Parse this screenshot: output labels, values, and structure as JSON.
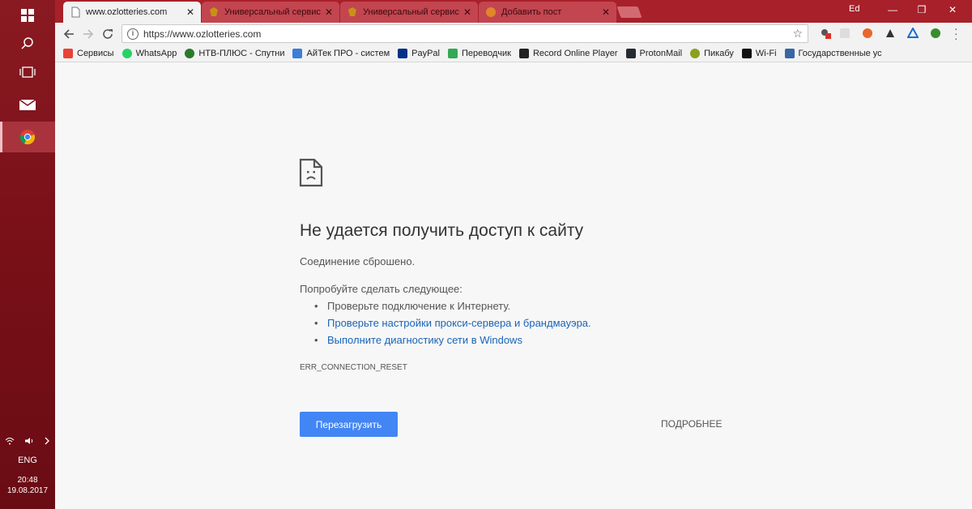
{
  "taskbar": {
    "items": [
      {
        "name": "start-button"
      },
      {
        "name": "search-button"
      },
      {
        "name": "task-view-button"
      },
      {
        "name": "mail-app"
      },
      {
        "name": "chrome-app"
      }
    ],
    "language": "ENG",
    "time": "20:48",
    "date": "19.08.2017"
  },
  "window": {
    "user": "Ed"
  },
  "tabs": [
    {
      "title": "www.ozlotteries.com",
      "active": true
    },
    {
      "title": "Универсальный сервис",
      "active": false
    },
    {
      "title": "Универсальный сервис",
      "active": false
    },
    {
      "title": "Добавить пост",
      "active": false
    }
  ],
  "omnibox": {
    "url": "https://www.ozlotteries.com"
  },
  "bookmarks": [
    {
      "label": "Сервисы",
      "color": "#e94235"
    },
    {
      "label": "WhatsApp",
      "color": "#25d366"
    },
    {
      "label": "НТВ-ПЛЮС - Спутни",
      "color": "#2a7a2a"
    },
    {
      "label": "АйТек ПРО - систем",
      "color": "#3b7dd8"
    },
    {
      "label": "PayPal",
      "color": "#003087"
    },
    {
      "label": "Переводчик",
      "color": "#34a853"
    },
    {
      "label": "Record Online Player",
      "color": "#222222"
    },
    {
      "label": "ProtonMail",
      "color": "#262a33"
    },
    {
      "label": "Пикабу",
      "color": "#8aa11e"
    },
    {
      "label": "Wi-Fi",
      "color": "#111111"
    },
    {
      "label": "Государственные ус",
      "color": "#3767a6"
    }
  ],
  "error": {
    "title": "Не удается получить доступ к сайту",
    "subtitle": "Соединение сброшено.",
    "try_text": "Попробуйте сделать следующее:",
    "suggestions": [
      {
        "text": "Проверьте подключение к Интернету.",
        "link": false
      },
      {
        "text": "Проверьте настройки прокси-сервера и брандмауэра.",
        "link": true
      },
      {
        "text": "Выполните диагностику сети в Windows",
        "link": true
      }
    ],
    "code": "ERR_CONNECTION_RESET",
    "reload_label": "Перезагрузить",
    "details_label": "ПОДРОБНЕЕ"
  },
  "colors": {
    "taskbar": "#7a1018",
    "tabstrip": "#a8202a",
    "button": "#4285f4",
    "link": "#1a64b9"
  }
}
